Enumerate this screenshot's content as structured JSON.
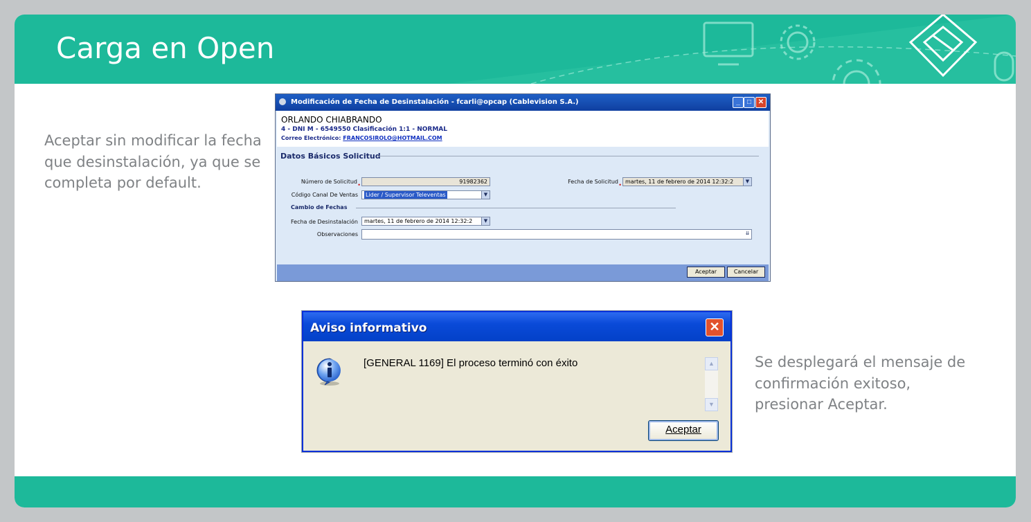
{
  "slide": {
    "title": "Carga en Open",
    "note_left": "Aceptar sin modificar la fecha que desinstalación, ya que se completa por default.",
    "note_right": "Se desplegará el mensaje de confirmación exitoso, presionar Aceptar."
  },
  "dialog1": {
    "title": "Modificación de Fecha de Desinstalación - fcarli@opcap (Cablevision S.A.)",
    "customer_name": "ORLANDO  CHIABRANDO",
    "customer_line": "4 - DNI M - 6549550 Clasificación 1:1 - NORMAL",
    "email_label": "Correo Electrónico:",
    "email": "FRANCOSIROLO@HOTMAIL.COM",
    "section_title": "Datos Básicos Solicitud",
    "fields": {
      "numero_label": "Número de Solicitud",
      "numero_value": "91982362",
      "fecha_solicitud_label": "Fecha de Solicitud",
      "fecha_solicitud_value": "martes, 11 de febrero de 2014 12:32:2",
      "canal_label": "Código Canal De Ventas",
      "canal_value": "Lider / Supervisor Televentas",
      "subsection_title": "Cambio de Fechas",
      "fecha_desinst_label": "Fecha de Desinstalación",
      "fecha_desinst_value": "martes, 11 de febrero de 2014 12:32:2",
      "observaciones_label": "Observaciones",
      "observaciones_value": ""
    },
    "buttons": {
      "accept": "Aceptar",
      "cancel": "Cancelar"
    }
  },
  "dialog2": {
    "title": "Aviso informativo",
    "message": "[GENERAL 1169] El proceso terminó con éxito",
    "ok": "Aceptar"
  },
  "colors": {
    "accent": "#1db99a",
    "text_gray": "#7f8285"
  }
}
